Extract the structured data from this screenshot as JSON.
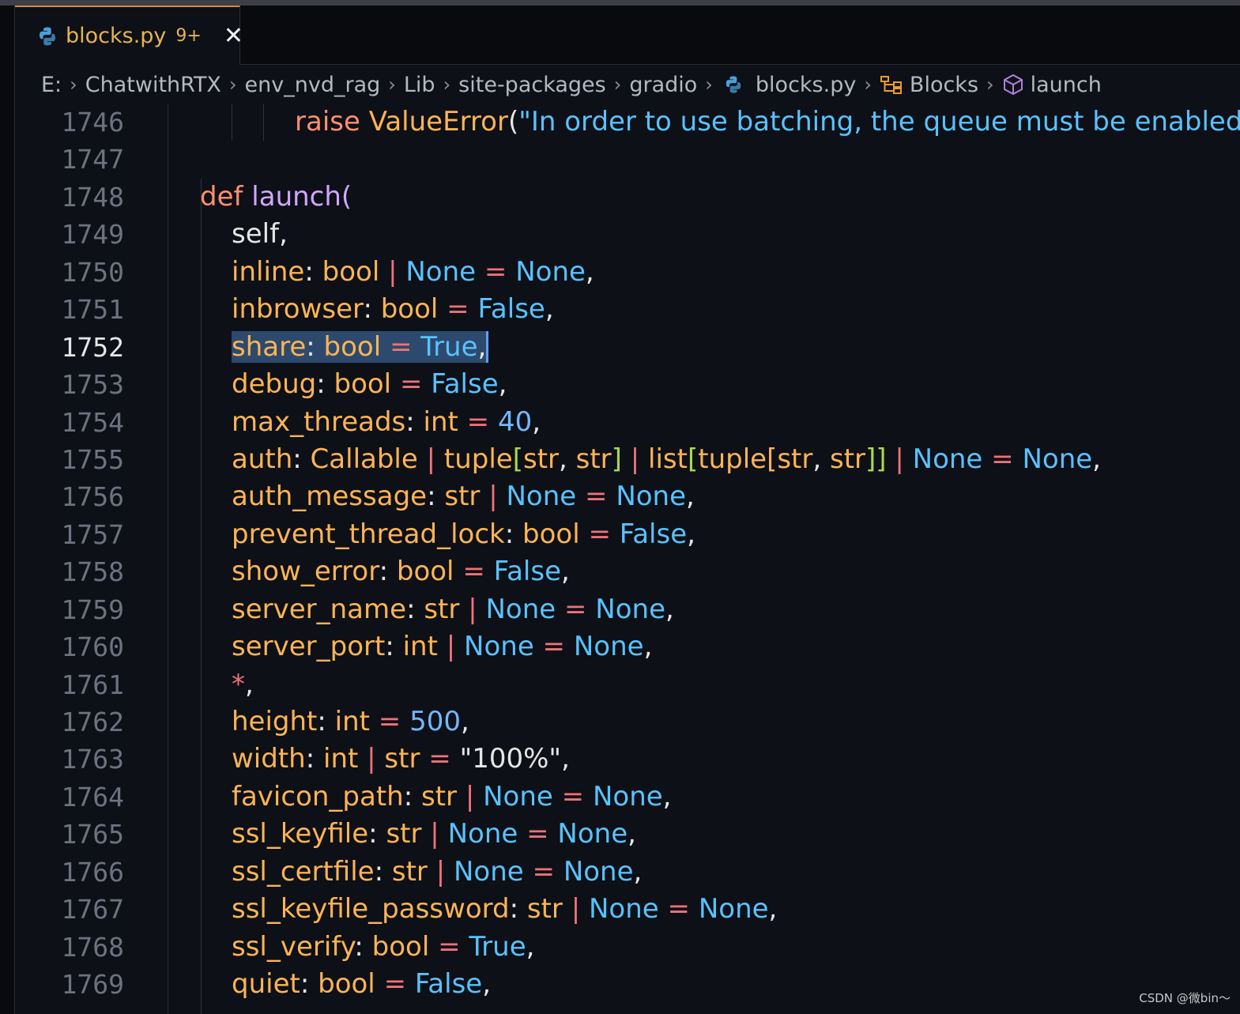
{
  "tab": {
    "title": "blocks.py",
    "badge": "9+",
    "close": "✕",
    "icon": "python-icon"
  },
  "breadcrumb": {
    "items": [
      "E:",
      "ChatwithRTX",
      "env_nvd_rag",
      "Lib",
      "site-packages",
      "gradio",
      "blocks.py",
      "Blocks",
      "launch"
    ],
    "separator": "›"
  },
  "editor": {
    "active_line": "1752",
    "line_numbers": [
      "1746",
      "1747",
      "1748",
      "1749",
      "1750",
      "1751",
      "1752",
      "1753",
      "1754",
      "1755",
      "1756",
      "1757",
      "1758",
      "1759",
      "1760",
      "1761",
      "1762",
      "1763",
      "1764",
      "1765",
      "1766",
      "1767",
      "1768",
      "1769"
    ],
    "lines": {
      "l1746": {
        "kw": "raise",
        "cls": "ValueError",
        "open": "(",
        "str": "\"In order to use batching, the queue must be enabled.\"",
        "close": ")"
      },
      "l1748": {
        "kw": "def",
        "fn": "launch",
        "open": "("
      },
      "l1749": {
        "p": "self",
        "c": ","
      },
      "l1750": {
        "p": "inline",
        "colon": ":",
        "t": "bool",
        "bar": "|",
        "v1": "None",
        "eq": "=",
        "v2": "None",
        "c": ","
      },
      "l1751": {
        "p": "inbrowser",
        "colon": ":",
        "t": "bool",
        "eq": "=",
        "v": "False",
        "c": ","
      },
      "l1752": {
        "p": "share",
        "colon": ":",
        "t": "bool",
        "eq": "=",
        "v": "True",
        "c": ","
      },
      "l1753": {
        "p": "debug",
        "colon": ":",
        "t": "bool",
        "eq": "=",
        "v": "False",
        "c": ","
      },
      "l1754": {
        "p": "max_threads",
        "colon": ":",
        "t": "int",
        "eq": "=",
        "v": "40",
        "c": ","
      },
      "l1755": {
        "p": "auth",
        "colon": ":",
        "t1": "Callable",
        "bar1": "|",
        "t2": "tuple",
        "b1": "[",
        "s1": "str",
        "cm1": ",",
        "s2": "str",
        "b2": "]",
        "bar2": "|",
        "t3": "list",
        "b3": "[",
        "t4": "tuple",
        "b4": "[",
        "s3": "str",
        "cm2": ",",
        "s4": "str",
        "b5": "]]",
        "bar3": "|",
        "v1": "None",
        "eq": "=",
        "v2": "None",
        "c": ","
      },
      "l1756": {
        "p": "auth_message",
        "colon": ":",
        "t": "str",
        "bar": "|",
        "v1": "None",
        "eq": "=",
        "v2": "None",
        "c": ","
      },
      "l1757": {
        "p": "prevent_thread_lock",
        "colon": ":",
        "t": "bool",
        "eq": "=",
        "v": "False",
        "c": ","
      },
      "l1758": {
        "p": "show_error",
        "colon": ":",
        "t": "bool",
        "eq": "=",
        "v": "False",
        "c": ","
      },
      "l1759": {
        "p": "server_name",
        "colon": ":",
        "t": "str",
        "bar": "|",
        "v1": "None",
        "eq": "=",
        "v2": "None",
        "c": ","
      },
      "l1760": {
        "p": "server_port",
        "colon": ":",
        "t": "int",
        "bar": "|",
        "v1": "None",
        "eq": "=",
        "v2": "None",
        "c": ","
      },
      "l1761": {
        "star": "*",
        "c": ","
      },
      "l1762": {
        "p": "height",
        "colon": ":",
        "t": "int",
        "eq": "=",
        "v": "500",
        "c": ","
      },
      "l1763": {
        "p": "width",
        "colon": ":",
        "t1": "int",
        "bar": "|",
        "t2": "str",
        "eq": "=",
        "v": "\"100%\"",
        "c": ","
      },
      "l1764": {
        "p": "favicon_path",
        "colon": ":",
        "t": "str",
        "bar": "|",
        "v1": "None",
        "eq": "=",
        "v2": "None",
        "c": ","
      },
      "l1765": {
        "p": "ssl_keyfile",
        "colon": ":",
        "t": "str",
        "bar": "|",
        "v1": "None",
        "eq": "=",
        "v2": "None",
        "c": ","
      },
      "l1766": {
        "p": "ssl_certfile",
        "colon": ":",
        "t": "str",
        "bar": "|",
        "v1": "None",
        "eq": "=",
        "v2": "None",
        "c": ","
      },
      "l1767": {
        "p": "ssl_keyfile_password",
        "colon": ":",
        "t": "str",
        "bar": "|",
        "v1": "None",
        "eq": "=",
        "v2": "None",
        "c": ","
      },
      "l1768": {
        "p": "ssl_verify",
        "colon": ":",
        "t": "bool",
        "eq": "=",
        "v": "True",
        "c": ","
      },
      "l1769": {
        "p": "quiet",
        "colon": ":",
        "t": "bool",
        "eq": "=",
        "v": "False",
        "c": ","
      }
    }
  },
  "watermark": "CSDN @微bin～",
  "colors": {
    "accent": "#e0813a",
    "keyword": "#ff8f70",
    "function": "#d2a6ff",
    "param": "#ffb454",
    "constant": "#59c2ff",
    "string": "#aad94c",
    "operator": "#f07178"
  }
}
